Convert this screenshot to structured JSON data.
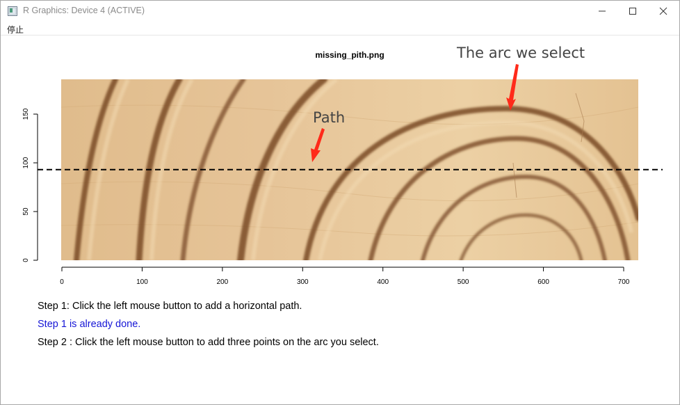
{
  "window": {
    "title": "R Graphics: Device 4 (ACTIVE)",
    "controls": [
      "minimize-icon",
      "maximize-icon",
      "close-icon"
    ]
  },
  "menu": {
    "items": [
      {
        "label": "停止"
      }
    ]
  },
  "plot": {
    "title": "missing_pith.png",
    "x_ticks": [
      "0",
      "100",
      "200",
      "300",
      "400",
      "500",
      "600",
      "700"
    ],
    "y_ticks": [
      "0",
      "50",
      "100",
      "150"
    ],
    "x_range": [
      0,
      700
    ],
    "y_range": [
      0,
      150
    ],
    "horizontal_path_y": 93,
    "annotations": {
      "arc_label": "The arc we select",
      "path_label": "Path",
      "arrow_color": "#ff2a1a"
    }
  },
  "instructions": {
    "step1": "Step 1: Click the left mouse button to add a horizontal path.",
    "status": "Step 1 is already done.",
    "step2": "Step 2 : Click the left mouse button to add three points on the arc you select.",
    "status_color": "#1515d6"
  }
}
